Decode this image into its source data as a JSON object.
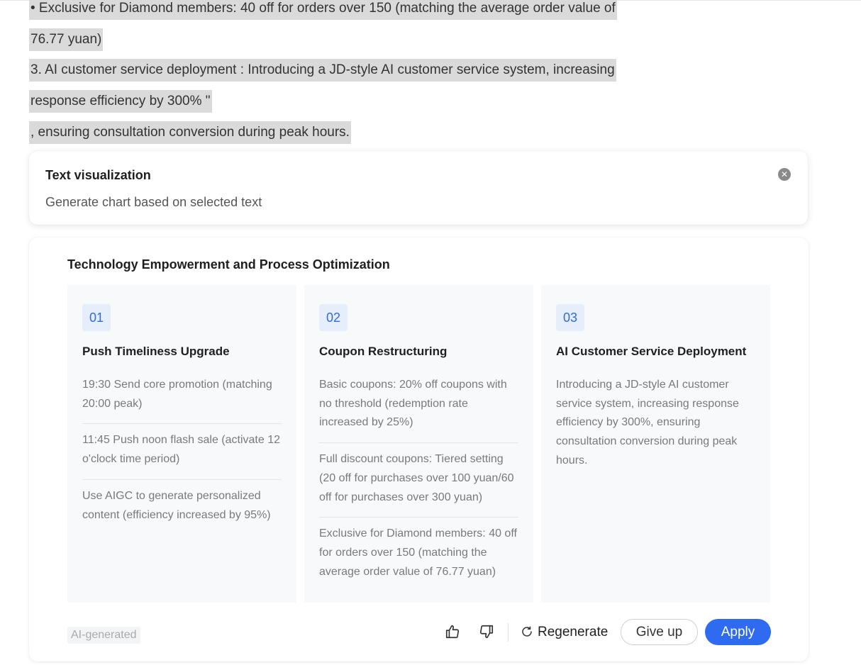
{
  "document": {
    "lines": [
      "• Exclusive for Diamond members: 40 off for orders over 150 (matching the average order value of",
      "76.77 yuan)",
      "3. AI customer service deployment : Introducing a JD-style AI customer service system, increasing",
      "response efficiency by 300% \"",
      ", ensuring consultation conversion during peak hours."
    ]
  },
  "popover": {
    "title": "Text visualization",
    "subtitle": "Generate chart based on selected text",
    "close_icon": "close-circle-icon"
  },
  "chart_data": {
    "type": "table",
    "title": "Technology Empowerment and Process Optimization",
    "columns": [
      {
        "number": "01",
        "title": "Push Timeliness Upgrade",
        "items": [
          "19:30 Send core promotion (matching 20:00 peak)",
          "11:45 Push noon flash sale (activate 12 o'clock time period)",
          "Use AIGC to generate personalized content (efficiency increased by 95%)"
        ]
      },
      {
        "number": "02",
        "title": "Coupon Restructuring",
        "items": [
          "Basic coupons: 20% off coupons with no threshold (redemption rate increased by 25%)",
          "Full discount coupons: Tiered setting (20 off for purchases over 100 yuan/60 off for purchases over 300 yuan)",
          "Exclusive for Diamond members: 40 off for orders over 150 (matching the average order value of 76.77 yuan)"
        ]
      },
      {
        "number": "03",
        "title": "AI Customer Service Deployment",
        "items": [
          "Introducing a JD-style AI customer service system, increasing response efficiency by 300%, ensuring consultation conversion during peak hours."
        ]
      }
    ]
  },
  "footer": {
    "ai_tag": "AI-generated",
    "like_icon": "thumbs-up-icon",
    "dislike_icon": "thumbs-down-icon",
    "regenerate_label": "Regenerate",
    "give_up_label": "Give up",
    "apply_label": "Apply"
  },
  "colors": {
    "accent": "#2f6bf0",
    "badge_bg": "#e6eefc",
    "badge_text": "#2f6be0",
    "selection": "#dadada"
  }
}
